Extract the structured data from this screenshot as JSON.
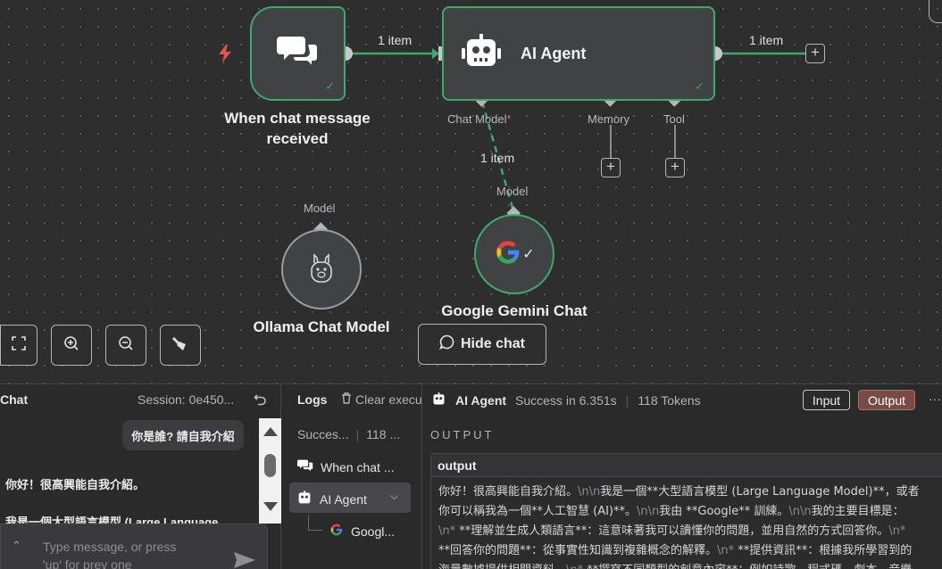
{
  "canvas": {
    "trigger_node": {
      "label": "When chat message received"
    },
    "agent_node": {
      "label": "AI Agent",
      "inputs": [
        "Chat Model",
        "Memory",
        "Tool"
      ],
      "required_marker": "*"
    },
    "connections": {
      "trigger_to_agent": "1 item",
      "agent_out": "1 item",
      "model_to_agent": "1 item"
    },
    "ollama_node": {
      "label": "Ollama Chat Model",
      "port_label": "Model"
    },
    "gemini_node": {
      "label": "Google Gemini Chat Model",
      "port_label": "Model"
    },
    "toolbar": {
      "hide_chat_label": "Hide chat",
      "icons": [
        "fit-view-icon",
        "zoom-in-icon",
        "zoom-out-icon",
        "tidy-up-icon"
      ]
    }
  },
  "chat": {
    "title": "Chat",
    "session": "Session: 0e450...",
    "user_message": "你是誰? 請自我介紹",
    "reply_line_1": "你好！很高興能自我介紹。",
    "reply_line_2": "我是一個大型語言模型 (Large Language",
    "input_placeholder_1": "Type message, or press",
    "input_placeholder_2": "'up' for prev one"
  },
  "logs": {
    "title": "Logs",
    "clear_label": "Clear execu",
    "summary_status": "Succes...",
    "summary_tokens": "118 ...",
    "items": [
      {
        "label": "When chat ..."
      },
      {
        "label": "AI Agent"
      },
      {
        "label": "Googl..."
      }
    ]
  },
  "output_panel": {
    "node_name": "AI Agent",
    "status": "Success in 6.351s",
    "tokens": "118 Tokens",
    "input_tab": "Input",
    "output_tab": "Output",
    "section_label": "OUTPUT",
    "field_name": "output",
    "lines": [
      [
        "你好！很高興能自我介紹。",
        "\\n\\n",
        "我是一個**大型語言模型 (Large Language Model)**，或者"
      ],
      [
        "你可以稱我為一個**人工智慧 (AI)**。",
        "\\n\\n",
        "我由 **Google** 訓練。",
        "\\n\\n",
        "我的主要目標是："
      ],
      [
        "",
        "\\n* ",
        "**理解並生成人類語言**：這意味著我可以讀懂你的問題，並用自然的方式回答你。",
        "\\n* "
      ],
      [
        "**回答你的問題**：從事實性知識到複雜概念的解釋。",
        "\\n* ",
        "**提供資訊**：根據我所學習到的"
      ],
      [
        "海量數據提供相關資料。",
        "\\n* ",
        "**撰寫不同類型的創意內容**：例如詩歌、程式碼、劇本、音樂"
      ]
    ]
  },
  "colors": {
    "success": "#3fa96a",
    "output_tab_bg": "#7a4a45",
    "trigger_bolt": "#e0554d"
  }
}
